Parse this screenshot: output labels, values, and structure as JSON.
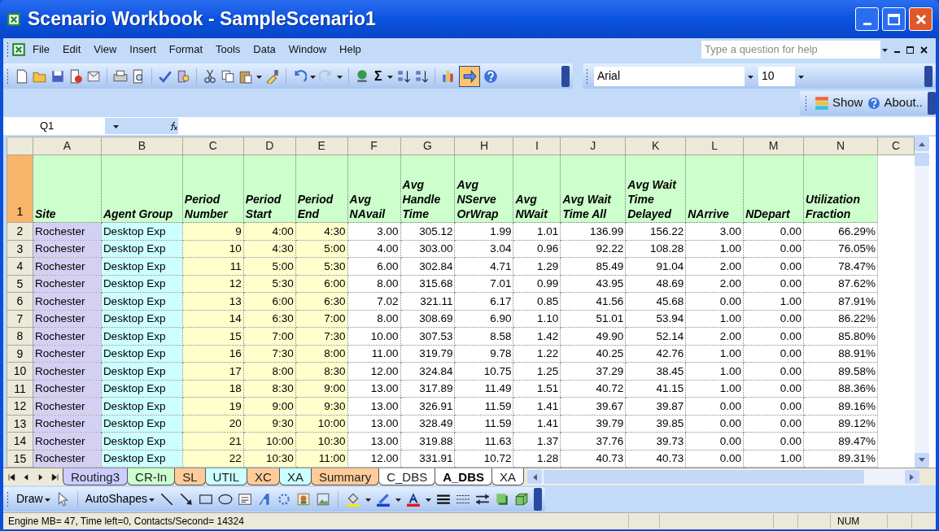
{
  "window": {
    "title": "Scenario Workbook - SampleScenario1"
  },
  "menu": [
    {
      "label": "File"
    },
    {
      "label": "Edit"
    },
    {
      "label": "View"
    },
    {
      "label": "Insert"
    },
    {
      "label": "Format"
    },
    {
      "label": "Tools"
    },
    {
      "label": "Data"
    },
    {
      "label": "Window"
    },
    {
      "label": "Help"
    }
  ],
  "help_box": {
    "placeholder": "Type a question for help"
  },
  "autosum": "Σ",
  "addin_button": {
    "pressed": true
  },
  "font_box": {
    "value": "Arial"
  },
  "size_box": {
    "value": "10"
  },
  "extra_toolbar": [
    {
      "label": "Show"
    },
    {
      "label": "About.."
    }
  ],
  "name_box": {
    "value": "Q1"
  },
  "columns": [
    {
      "label": "A"
    },
    {
      "label": "B"
    },
    {
      "label": "C"
    },
    {
      "label": "D"
    },
    {
      "label": "E"
    },
    {
      "label": "F"
    },
    {
      "label": "G"
    },
    {
      "label": "H"
    },
    {
      "label": "I"
    },
    {
      "label": "J"
    },
    {
      "label": "K"
    },
    {
      "label": "L"
    },
    {
      "label": "M"
    },
    {
      "label": "N"
    },
    {
      "label": "C"
    }
  ],
  "column_fills": [
    {
      "color": "#d4d0f4"
    },
    {
      "color": "#ccffff"
    },
    {
      "color": "#ffffcc"
    },
    {
      "color": "#ffffcc"
    },
    {
      "color": "#ffffcc"
    },
    {
      "color": "#ffffff"
    },
    {
      "color": "#ffffff"
    },
    {
      "color": "#ffffff"
    },
    {
      "color": "#ffffff"
    },
    {
      "color": "#ffffff"
    },
    {
      "color": "#ffffff"
    },
    {
      "color": "#ffffff"
    },
    {
      "color": "#ffffff"
    },
    {
      "color": "#ffffff"
    }
  ],
  "header_row": {
    "number": "1",
    "selected": true,
    "cells": [
      "Site",
      "Agent Group",
      "Period Number",
      "Period Start",
      "Period End",
      "Avg NAvail",
      "Avg Handle Time",
      "Avg NServe OrWrap",
      "Avg NWait",
      "Avg Wait Time All",
      "Avg Wait Time Delayed",
      "NArrive",
      "NDepart",
      "Utilization Fraction"
    ]
  },
  "rows": [
    {
      "number": "2",
      "selected": false,
      "cells": [
        "Rochester",
        "Desktop Exp",
        "9",
        "4:00",
        "4:30",
        "3.00",
        "305.12",
        "1.99",
        "1.01",
        "136.99",
        "156.22",
        "3.00",
        "0.00",
        "66.29%"
      ]
    },
    {
      "number": "3",
      "selected": false,
      "cells": [
        "Rochester",
        "Desktop Exp",
        "10",
        "4:30",
        "5:00",
        "4.00",
        "303.00",
        "3.04",
        "0.96",
        "92.22",
        "108.28",
        "1.00",
        "0.00",
        "76.05%"
      ]
    },
    {
      "number": "4",
      "selected": false,
      "cells": [
        "Rochester",
        "Desktop Exp",
        "11",
        "5:00",
        "5:30",
        "6.00",
        "302.84",
        "4.71",
        "1.29",
        "85.49",
        "91.04",
        "2.00",
        "0.00",
        "78.47%"
      ]
    },
    {
      "number": "5",
      "selected": false,
      "cells": [
        "Rochester",
        "Desktop Exp",
        "12",
        "5:30",
        "6:00",
        "8.00",
        "315.68",
        "7.01",
        "0.99",
        "43.95",
        "48.69",
        "2.00",
        "0.00",
        "87.62%"
      ]
    },
    {
      "number": "6",
      "selected": false,
      "cells": [
        "Rochester",
        "Desktop Exp",
        "13",
        "6:00",
        "6:30",
        "7.02",
        "321.11",
        "6.17",
        "0.85",
        "41.56",
        "45.68",
        "0.00",
        "1.00",
        "87.91%"
      ]
    },
    {
      "number": "7",
      "selected": false,
      "cells": [
        "Rochester",
        "Desktop Exp",
        "14",
        "6:30",
        "7:00",
        "8.00",
        "308.69",
        "6.90",
        "1.10",
        "51.01",
        "53.94",
        "1.00",
        "0.00",
        "86.22%"
      ]
    },
    {
      "number": "8",
      "selected": false,
      "cells": [
        "Rochester",
        "Desktop Exp",
        "15",
        "7:00",
        "7:30",
        "10.00",
        "307.53",
        "8.58",
        "1.42",
        "49.90",
        "52.14",
        "2.00",
        "0.00",
        "85.80%"
      ]
    },
    {
      "number": "9",
      "selected": false,
      "cells": [
        "Rochester",
        "Desktop Exp",
        "16",
        "7:30",
        "8:00",
        "11.00",
        "319.79",
        "9.78",
        "1.22",
        "40.25",
        "42.76",
        "1.00",
        "0.00",
        "88.91%"
      ]
    },
    {
      "number": "10",
      "selected": false,
      "cells": [
        "Rochester",
        "Desktop Exp",
        "17",
        "8:00",
        "8:30",
        "12.00",
        "324.84",
        "10.75",
        "1.25",
        "37.29",
        "38.45",
        "1.00",
        "0.00",
        "89.58%"
      ]
    },
    {
      "number": "11",
      "selected": false,
      "cells": [
        "Rochester",
        "Desktop Exp",
        "18",
        "8:30",
        "9:00",
        "13.00",
        "317.89",
        "11.49",
        "1.51",
        "40.72",
        "41.15",
        "1.00",
        "0.00",
        "88.36%"
      ]
    },
    {
      "number": "12",
      "selected": false,
      "cells": [
        "Rochester",
        "Desktop Exp",
        "19",
        "9:00",
        "9:30",
        "13.00",
        "326.91",
        "11.59",
        "1.41",
        "39.67",
        "39.87",
        "0.00",
        "0.00",
        "89.16%"
      ]
    },
    {
      "number": "13",
      "selected": false,
      "cells": [
        "Rochester",
        "Desktop Exp",
        "20",
        "9:30",
        "10:00",
        "13.00",
        "328.49",
        "11.59",
        "1.41",
        "39.79",
        "39.85",
        "0.00",
        "0.00",
        "89.12%"
      ]
    },
    {
      "number": "14",
      "selected": false,
      "cells": [
        "Rochester",
        "Desktop Exp",
        "21",
        "10:00",
        "10:30",
        "13.00",
        "319.88",
        "11.63",
        "1.37",
        "37.76",
        "39.73",
        "0.00",
        "0.00",
        "89.47%"
      ]
    },
    {
      "number": "15",
      "selected": false,
      "cells": [
        "Rochester",
        "Desktop Exp",
        "22",
        "10:30",
        "11:00",
        "12.00",
        "331.91",
        "10.72",
        "1.28",
        "40.73",
        "40.73",
        "0.00",
        "1.00",
        "89.31%"
      ]
    }
  ],
  "sheet_tabs": [
    {
      "label": "Routing3",
      "color": "#ccccff",
      "selected": false
    },
    {
      "label": "CR-In",
      "color": "#ccffcc",
      "selected": false
    },
    {
      "label": "SL",
      "color": "#ffcc99",
      "selected": false
    },
    {
      "label": "UTIL",
      "color": "#ccffff",
      "selected": false
    },
    {
      "label": "XC",
      "color": "#ffcc99",
      "selected": false
    },
    {
      "label": "XA",
      "color": "#ccffff",
      "selected": false
    },
    {
      "label": "Summary",
      "color": "#ffcc99",
      "selected": false
    },
    {
      "label": "C_DBS",
      "color": "#ffffff",
      "selected": false
    },
    {
      "label": "A_DBS",
      "color": "#ffffff",
      "selected": true
    },
    {
      "label": "XA",
      "color": "#ffffff",
      "selected": false
    }
  ],
  "drawing_toolbar": [
    {
      "label": "Draw"
    },
    {
      "label": "AutoShapes"
    }
  ],
  "status_bar": {
    "message": "Engine MB= 47, Time left=0, Contacts/Second= 14324",
    "indicator": "NUM"
  }
}
